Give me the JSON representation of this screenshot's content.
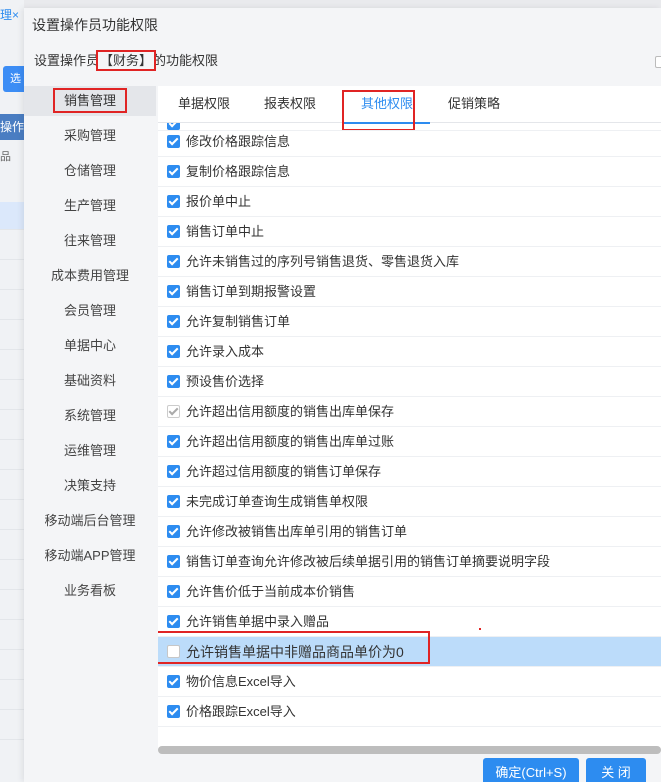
{
  "background": {
    "tab_label": "理",
    "tab_close": "×",
    "button_label": "选",
    "header_label": "操作",
    "sub_label": "品"
  },
  "dialog": {
    "title": "设置操作员功能权限",
    "subtitle_prefix": "设置操作员",
    "subtitle_name": "【财务】",
    "subtitle_suffix": "的功能权限"
  },
  "menu": {
    "items": [
      {
        "label": "销售管理",
        "active": true
      },
      {
        "label": "采购管理"
      },
      {
        "label": "仓储管理"
      },
      {
        "label": "生产管理"
      },
      {
        "label": "往来管理"
      },
      {
        "label": "成本费用管理"
      },
      {
        "label": "会员管理"
      },
      {
        "label": "单据中心"
      },
      {
        "label": "基础资料"
      },
      {
        "label": "系统管理"
      },
      {
        "label": "运维管理"
      },
      {
        "label": "决策支持"
      },
      {
        "label": "移动端后台管理"
      },
      {
        "label": "移动端APP管理"
      },
      {
        "label": "业务看板"
      }
    ]
  },
  "tabs": [
    {
      "label": "单据权限"
    },
    {
      "label": "报表权限"
    },
    {
      "label": "其他权限",
      "active": true
    },
    {
      "label": "促销策略"
    }
  ],
  "permissions": [
    {
      "label": "修改价格跟踪信息",
      "state": "checked"
    },
    {
      "label": "复制价格跟踪信息",
      "state": "checked"
    },
    {
      "label": "报价单中止",
      "state": "checked"
    },
    {
      "label": "销售订单中止",
      "state": "checked"
    },
    {
      "label": "允许未销售过的序列号销售退货、零售退货入库",
      "state": "checked"
    },
    {
      "label": "销售订单到期报警设置",
      "state": "checked"
    },
    {
      "label": "允许复制销售订单",
      "state": "checked"
    },
    {
      "label": "允许录入成本",
      "state": "checked"
    },
    {
      "label": "预设售价选择",
      "state": "checked"
    },
    {
      "label": "允许超出信用额度的销售出库单保存",
      "state": "disabled"
    },
    {
      "label": "允许超出信用额度的销售出库单过账",
      "state": "checked"
    },
    {
      "label": "允许超过信用额度的销售订单保存",
      "state": "checked"
    },
    {
      "label": "未完成订单查询生成销售单权限",
      "state": "checked"
    },
    {
      "label": "允许修改被销售出库单引用的销售订单",
      "state": "checked"
    },
    {
      "label": "销售订单查询允许修改被后续单据引用的销售订单摘要说明字段",
      "state": "checked"
    },
    {
      "label": "允许售价低于当前成本价销售",
      "state": "checked"
    },
    {
      "label": "允许销售单据中录入赠品",
      "state": "checked"
    },
    {
      "label": "允许销售单据中非赠品商品单价为0",
      "state": "unchecked",
      "highlighted": true
    },
    {
      "label": "物价信息Excel导入",
      "state": "checked"
    },
    {
      "label": "价格跟踪Excel导入",
      "state": "checked"
    }
  ],
  "footer": {
    "ok_label": "确定(Ctrl+S)",
    "close_label": "关 闭"
  },
  "colors": {
    "accent": "#2d8cf0",
    "annotation": "#e02424",
    "row_highlight": "#bcdcfa"
  }
}
